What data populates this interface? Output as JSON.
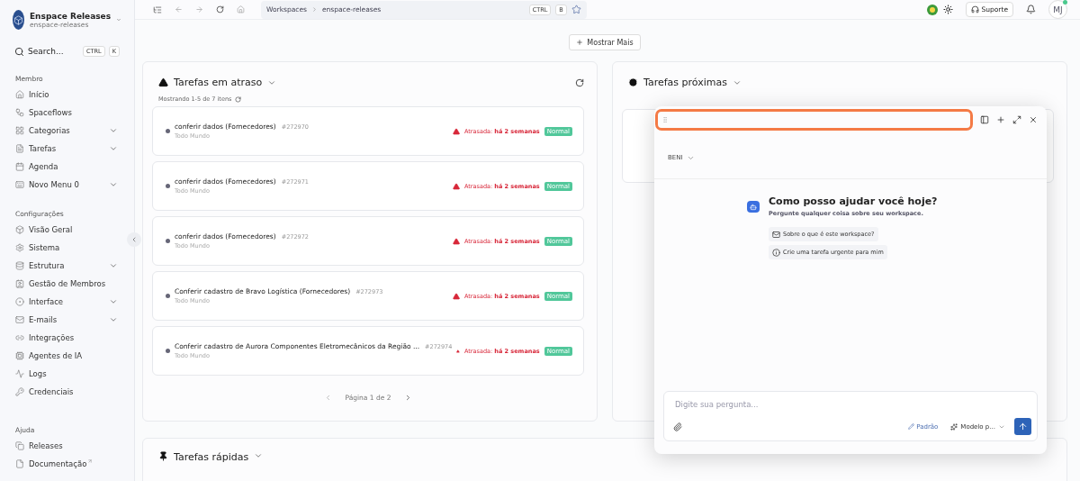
{
  "workspace": {
    "name": "Enspace Releases",
    "slug": "enspace-releases"
  },
  "search": {
    "label": "Search...",
    "keys": [
      "CTRL",
      "K"
    ]
  },
  "sidebar": {
    "sections": [
      {
        "title": "Membro",
        "items": [
          {
            "label": "Início",
            "submenu": false
          },
          {
            "label": "Spaceflows",
            "submenu": false
          },
          {
            "label": "Categorias",
            "submenu": true
          },
          {
            "label": "Tarefas",
            "submenu": true
          },
          {
            "label": "Agenda",
            "submenu": false
          },
          {
            "label": "Novo Menu 0",
            "submenu": true
          }
        ]
      },
      {
        "title": "Configurações",
        "items": [
          {
            "label": "Visão Geral",
            "submenu": false
          },
          {
            "label": "Sistema",
            "submenu": false
          },
          {
            "label": "Estrutura",
            "submenu": true
          },
          {
            "label": "Gestão de Membros",
            "submenu": false
          },
          {
            "label": "Interface",
            "submenu": true
          },
          {
            "label": "E-mails",
            "submenu": true
          },
          {
            "label": "Integrações",
            "submenu": false
          },
          {
            "label": "Agentes de IA",
            "submenu": false
          },
          {
            "label": "Logs",
            "submenu": false
          },
          {
            "label": "Credenciais",
            "submenu": false
          }
        ]
      },
      {
        "title": "Ajuda",
        "items": [
          {
            "label": "Releases",
            "submenu": false
          },
          {
            "label": "Documentação",
            "submenu": false,
            "external": true
          }
        ]
      }
    ]
  },
  "breadcrumb": [
    "Workspaces",
    "enspace-releases"
  ],
  "shortcut": [
    "CTRL",
    "B"
  ],
  "topbar": {
    "support": "Suporte",
    "avatar": "MJ"
  },
  "show_more": "Mostrar Mais",
  "overdue": {
    "title": "Tarefas em atraso",
    "summary": "Mostrando 1-5 de 7 itens",
    "page": "Página 1 de 2",
    "tasks": [
      {
        "title": "conferir dados (Fornecedores)",
        "id": "#272970",
        "assignee": "Todo Mundo",
        "status": "Atrasada:",
        "when": "há 2 semanas",
        "priority": "Normal"
      },
      {
        "title": "conferir dados (Fornecedores)",
        "id": "#272971",
        "assignee": "Todo Mundo",
        "status": "Atrasada:",
        "when": "há 2 semanas",
        "priority": "Normal"
      },
      {
        "title": "conferir dados (Fornecedores)",
        "id": "#272972",
        "assignee": "Todo Mundo",
        "status": "Atrasada:",
        "when": "há 2 semanas",
        "priority": "Normal"
      },
      {
        "title": "Conferir cadastro de Bravo Logística (Fornecedores)",
        "id": "#272973",
        "assignee": "Todo Mundo",
        "status": "Atrasada:",
        "when": "há 2 semanas",
        "priority": "Normal"
      },
      {
        "title": "Conferir cadastro de Aurora Componentes Eletromecânicos da Região ...",
        "id": "#272974",
        "assignee": "Todo Mundo",
        "status": "Atrasada:",
        "when": "há 2 semanas",
        "priority": "Normal"
      }
    ]
  },
  "upcoming": {
    "title": "Tarefas próximas"
  },
  "quick": {
    "title": "Tarefas rápidas"
  },
  "chat": {
    "agent": "BENI",
    "heading": "Como posso ajudar você hoje?",
    "subheading": "Pergunte qualquer coisa sobre seu workspace.",
    "suggestions": [
      {
        "kind": "mail",
        "text": "Sobre o que é este workspace?"
      },
      {
        "kind": "info",
        "text": "Crie uma tarefa urgente para mim"
      }
    ],
    "placeholder": "Digite sua pergunta...",
    "mode": "Padrão",
    "model": "Modelo p..."
  }
}
